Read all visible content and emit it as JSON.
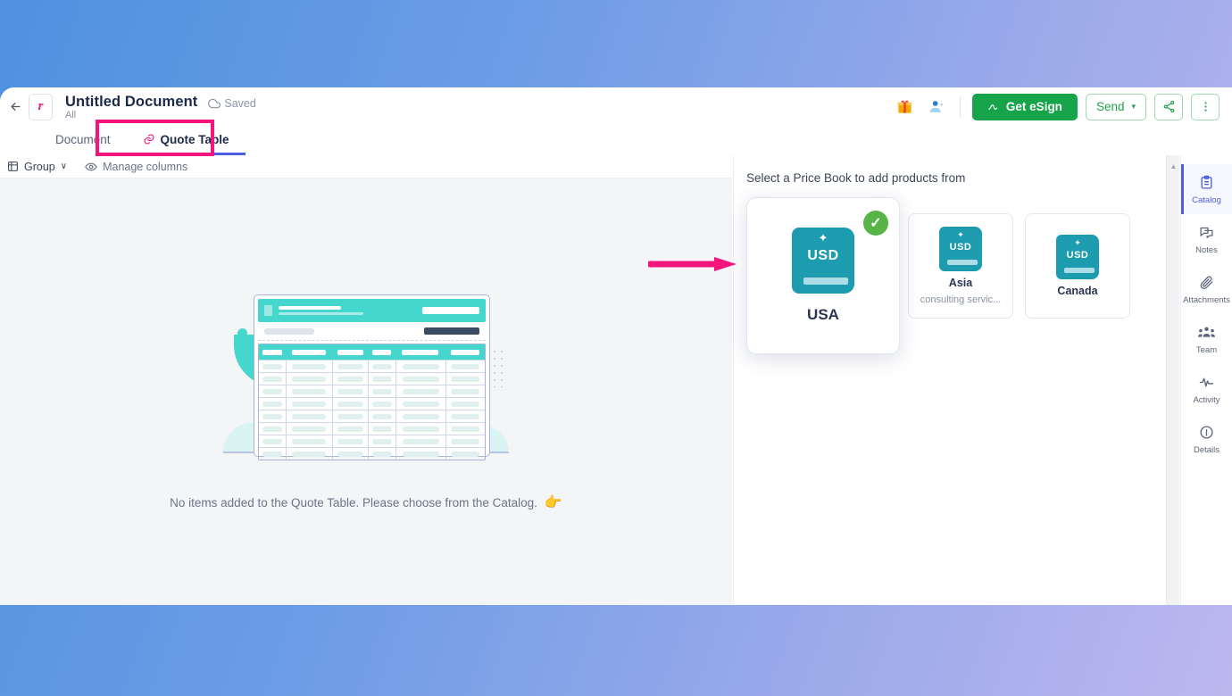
{
  "header": {
    "back_icon": "back-arrow-icon",
    "doc_badge_letter": "r",
    "title": "Untitled Document",
    "subtitle": "All",
    "saved_label": "Saved",
    "saved_icon": "cloud-icon",
    "gift_icon": "gift-icon",
    "user_icon": "user-add-icon",
    "esign_label": "Get eSign",
    "esign_icon": "signature-pen-icon",
    "send_label": "Send",
    "send_caret": "▾",
    "share_icon": "share-icon",
    "more_icon": "more-vertical-icon"
  },
  "tabs": [
    {
      "label": "Document",
      "icon": "",
      "active": false
    },
    {
      "label": "Quote Table",
      "icon": "link-icon",
      "active": true
    }
  ],
  "toolbar": {
    "group_label": "Group",
    "group_caret": "∨",
    "group_icon": "group-icon",
    "manage_columns_label": "Manage columns",
    "manage_columns_icon": "eye-icon"
  },
  "empty_state": {
    "message": "No items added to the Quote Table. Please choose from the Catalog.",
    "hand_icon": "👉",
    "illustration": "quote-table-placeholder"
  },
  "catalog": {
    "panel_title": "Select a Price Book to add products from",
    "price_books": [
      {
        "name": "USA",
        "currency": "USD",
        "description": "",
        "selected": true
      },
      {
        "name": "Asia",
        "currency": "USD",
        "description": "consulting servic...",
        "selected": false
      },
      {
        "name": "Canada",
        "currency": "USD",
        "description": "",
        "selected": false
      }
    ],
    "check_glyph": "✓"
  },
  "right_rail": [
    {
      "label": "Catalog",
      "icon": "clipboard-icon",
      "active": true
    },
    {
      "label": "Notes",
      "icon": "notes-icon",
      "active": false
    },
    {
      "label": "Attachments",
      "icon": "paperclip-icon",
      "active": false
    },
    {
      "label": "Team",
      "icon": "team-icon",
      "active": false
    },
    {
      "label": "Activity",
      "icon": "activity-icon",
      "active": false
    },
    {
      "label": "Details",
      "icon": "info-icon",
      "active": false
    }
  ],
  "annotations": {
    "highlight_color": "#f6157f",
    "arrow_color": "#f6157f",
    "highlight_target": "Quote Table",
    "arrow_target": "USA price book card"
  },
  "colors": {
    "background_gradient_start": "#4f91df",
    "background_gradient_end": "#bdb7ef",
    "accent_green": "#16a34a",
    "accent_indigo": "#4f5ee0",
    "accent_teal": "#1d9cb0",
    "check_green": "#58b446",
    "annotation_pink": "#f6157f"
  }
}
